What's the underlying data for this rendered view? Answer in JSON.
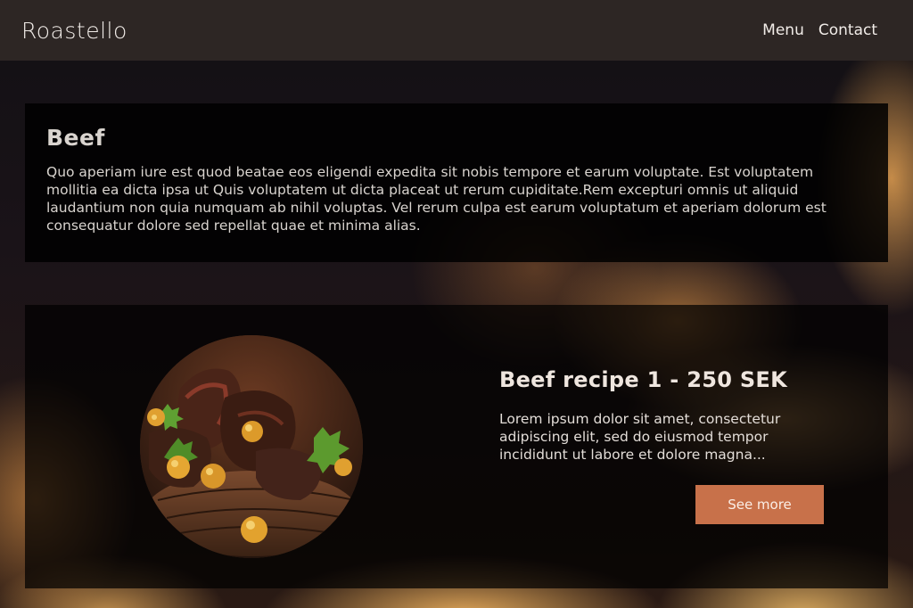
{
  "header": {
    "brand": "Roastello",
    "nav": [
      {
        "label": "Menu"
      },
      {
        "label": "Contact"
      }
    ]
  },
  "intro": {
    "title": "Beef",
    "text": "Quo aperiam iure est quod beatae eos eligendi expedita sit nobis tempore et earum voluptate. Est voluptatem mollitia ea dicta ipsa ut Quis voluptatem ut dicta placeat ut rerum cupiditate.Rem excepturi omnis ut aliquid laudantium non quia numquam ab nihil voluptas. Vel rerum culpa est earum voluptatum et aperiam dolorum est consequatur dolore sed repellat quae et minima alias."
  },
  "recipe": {
    "title": "Beef recipe 1 - 250 SEK",
    "description": "Lorem ipsum dolor sit amet, consectetur adipiscing elit, sed do eiusmod tempor incididunt ut labore et dolore magna...",
    "button_label": "See more",
    "image_icon": "beef-dish-photo"
  },
  "colors": {
    "header_bg": "#2d2624",
    "accent_button": "#c8714a"
  }
}
